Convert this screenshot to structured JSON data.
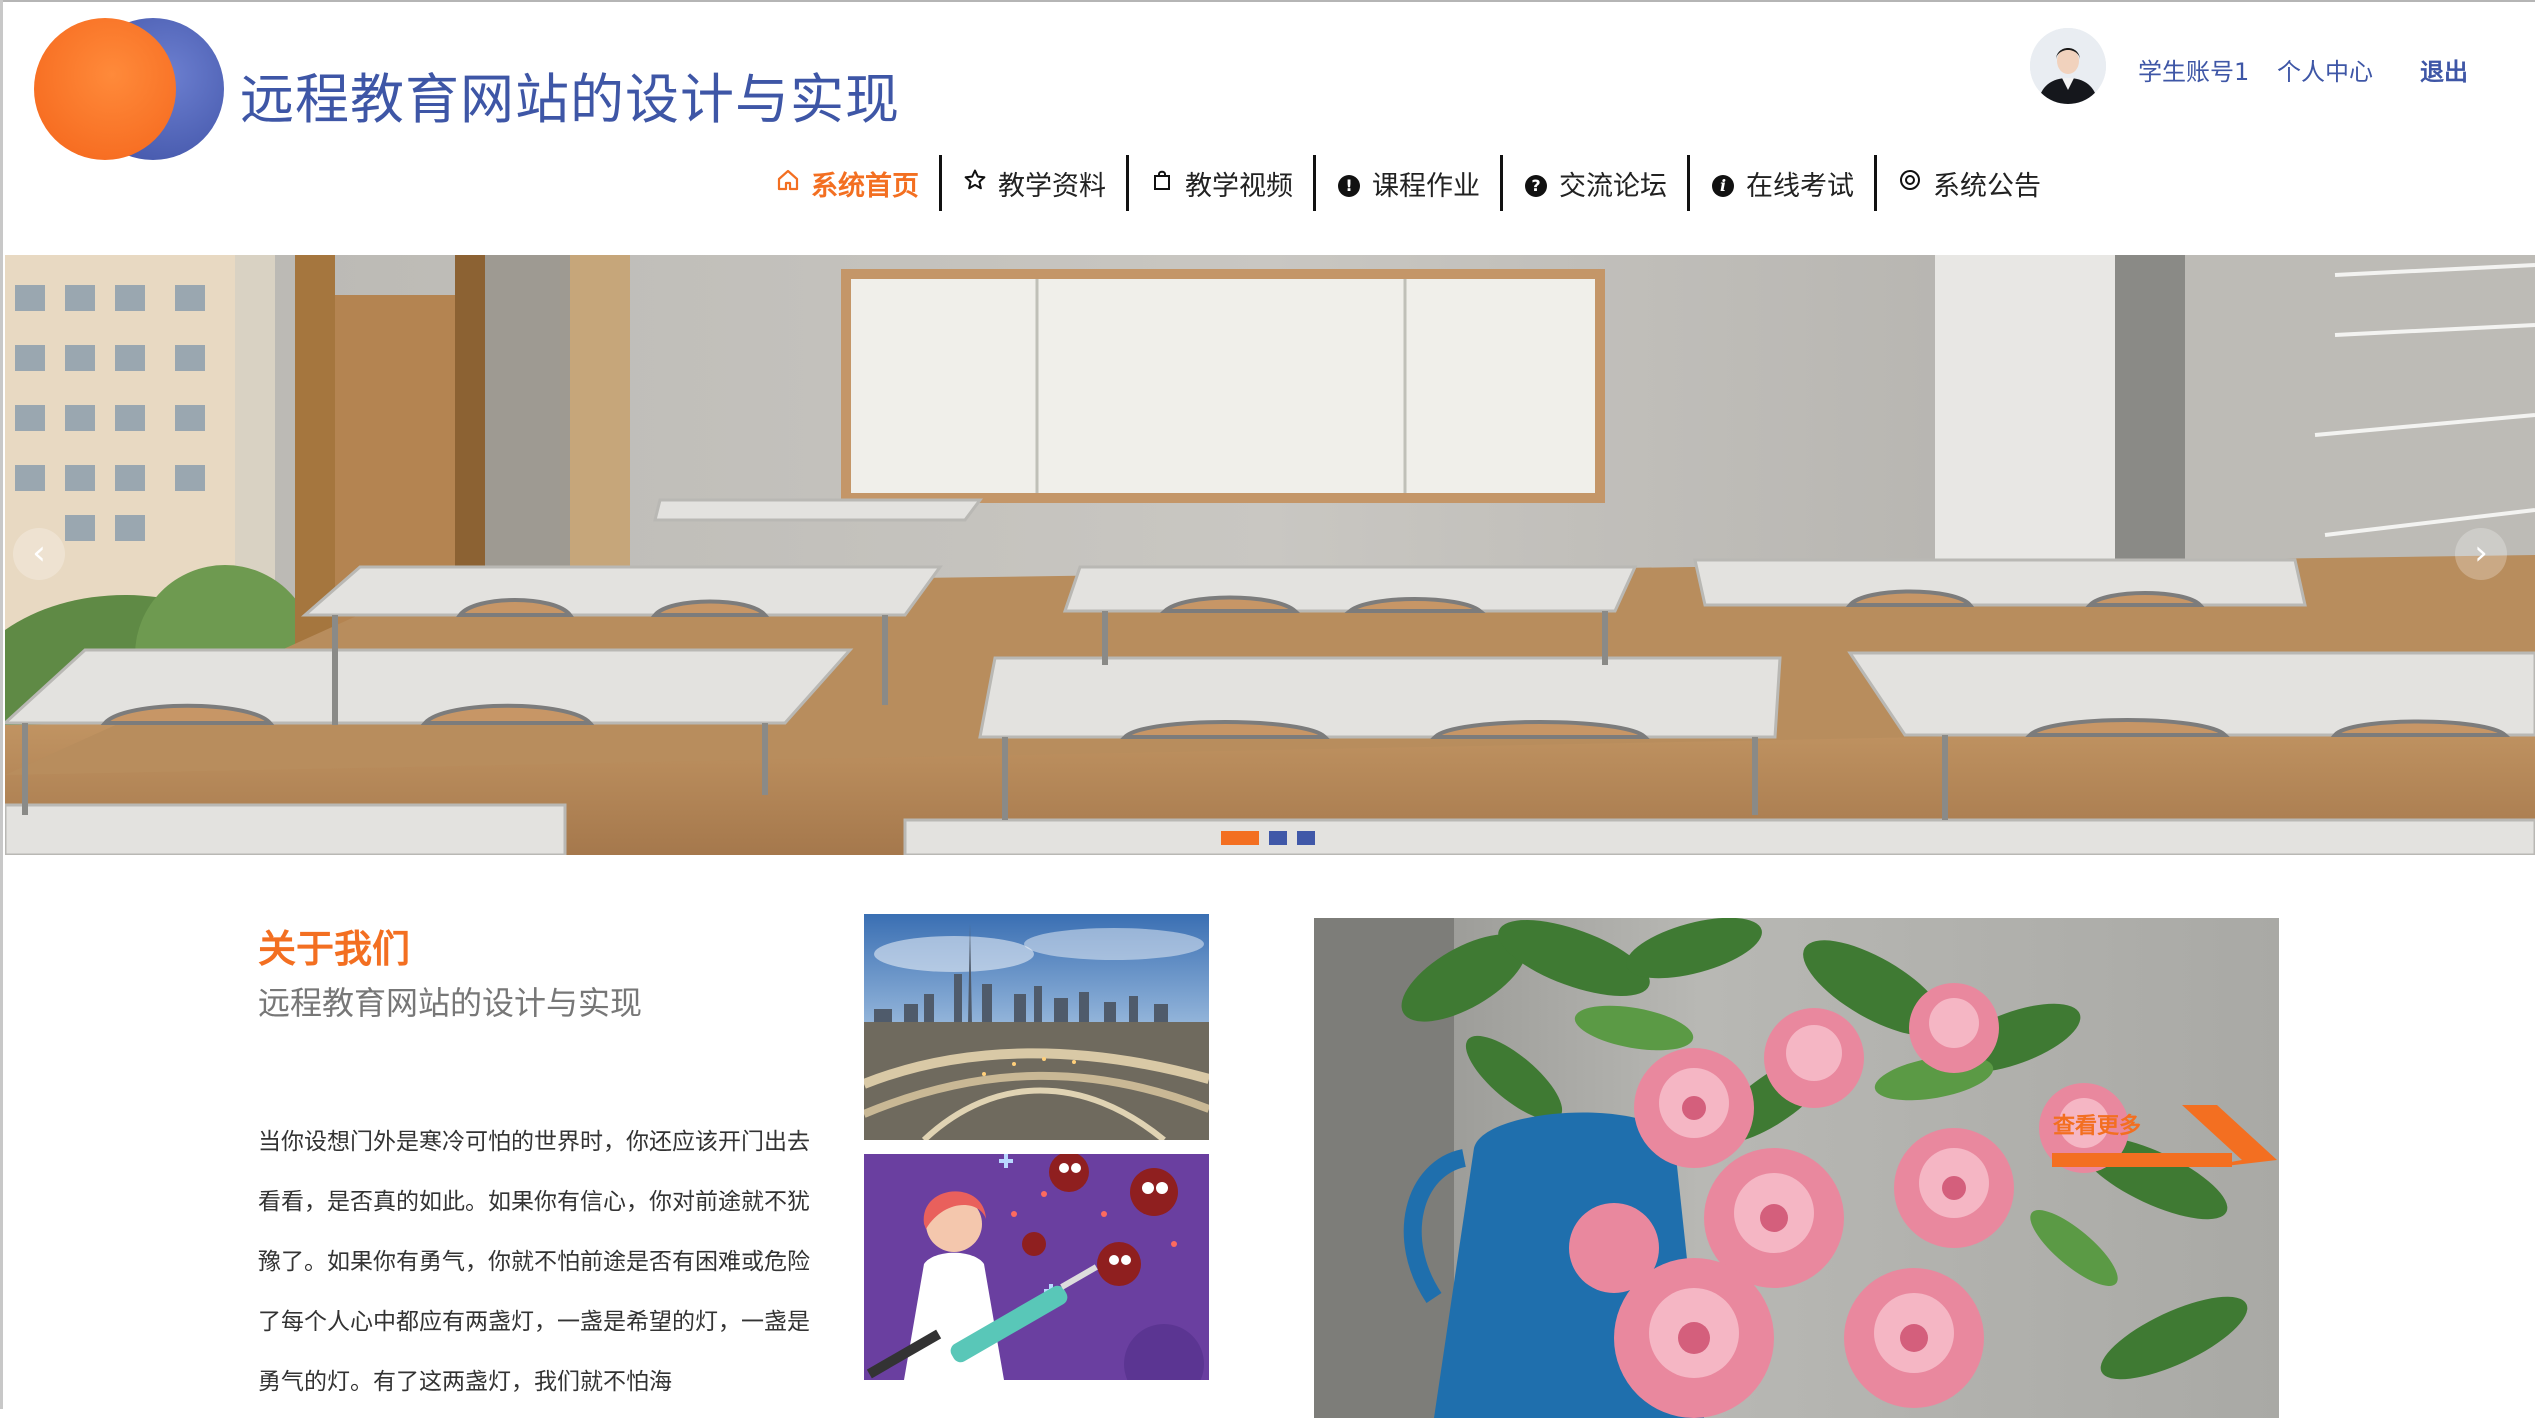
{
  "site": {
    "title": "远程教育网站的设计与实现"
  },
  "user_bar": {
    "username": "学生账号1",
    "profile_label": "个人中心",
    "logout_label": "退出"
  },
  "nav": {
    "items": [
      {
        "label": "系统首页",
        "icon": "home-icon",
        "active": true
      },
      {
        "label": "教学资料",
        "icon": "star-icon",
        "active": false
      },
      {
        "label": "教学视频",
        "icon": "bag-icon",
        "active": false
      },
      {
        "label": "课程作业",
        "icon": "info-icon",
        "active": false
      },
      {
        "label": "交流论坛",
        "icon": "question-icon",
        "active": false
      },
      {
        "label": "在线考试",
        "icon": "info-icon",
        "active": false
      },
      {
        "label": "系统公告",
        "icon": "settings-icon",
        "active": false
      }
    ]
  },
  "carousel": {
    "prev_icon": "chevron-left-icon",
    "next_icon": "chevron-right-icon",
    "slide_count": 3,
    "active_index": 0
  },
  "about": {
    "title": "关于我们",
    "subtitle": "远程教育网站的设计与实现",
    "body": "当你设想门外是寒冷可怕的世界时，你还应该开门出去看看，是否真的如此。如果你有信心，你对前途就不犹豫了。如果你有勇气，你就不怕前途是否有困难或危险了每个人心中都应有两盏灯，一盏是希望的灯，一盏是勇气的灯。有了这两盏灯，我们就不怕海"
  },
  "more": {
    "label": "查看更多"
  },
  "colors": {
    "brand_blue": "#3e56a6",
    "accent_orange": "#f36f21"
  }
}
